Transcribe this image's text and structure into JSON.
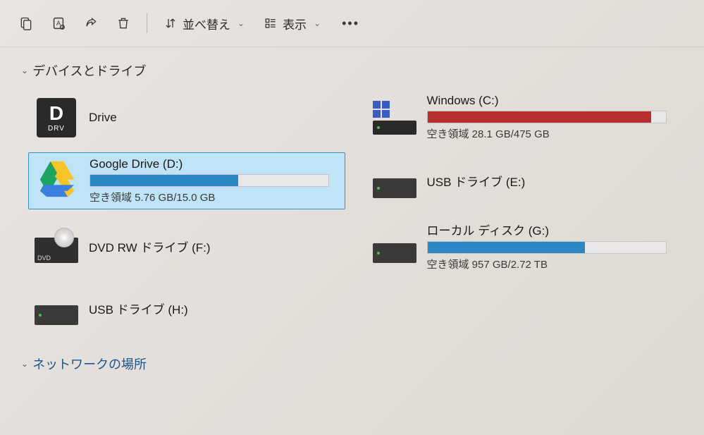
{
  "toolbar": {
    "sort_label": "並べ替え",
    "view_label": "表示"
  },
  "sections": {
    "devices_header": "デバイスとドライブ",
    "network_header": "ネットワークの場所"
  },
  "drives": [
    {
      "name": "Drive",
      "icon": "drv",
      "selected": false,
      "has_bar": false
    },
    {
      "name": "Windows (C:)",
      "icon": "windisk",
      "selected": false,
      "has_bar": true,
      "fill_percent": 94,
      "fill_color": "red",
      "free_text": "空き領域 28.1 GB/475 GB"
    },
    {
      "name": "Google Drive (D:)",
      "icon": "gdrive",
      "selected": true,
      "has_bar": true,
      "fill_percent": 62,
      "fill_color": "blue",
      "free_text": "空き領域 5.76 GB/15.0 GB"
    },
    {
      "name": "USB ドライブ (E:)",
      "icon": "usb",
      "selected": false,
      "has_bar": false
    },
    {
      "name": "DVD RW ドライブ (F:)",
      "icon": "dvd",
      "selected": false,
      "has_bar": false
    },
    {
      "name": "ローカル ディスク (G:)",
      "icon": "localdisk",
      "selected": false,
      "has_bar": true,
      "fill_percent": 66,
      "fill_color": "blue",
      "free_text": "空き領域 957 GB/2.72 TB"
    },
    {
      "name": "USB ドライブ (H:)",
      "icon": "usb",
      "selected": false,
      "has_bar": false
    }
  ]
}
